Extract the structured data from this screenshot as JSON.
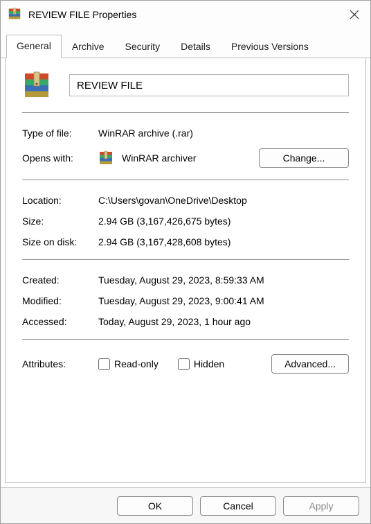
{
  "window": {
    "title": "REVIEW FILE Properties"
  },
  "tabs": {
    "general": "General",
    "archive": "Archive",
    "security": "Security",
    "details": "Details",
    "previous_versions": "Previous Versions"
  },
  "filename": "REVIEW FILE",
  "labels": {
    "type_of_file": "Type of file:",
    "opens_with": "Opens with:",
    "location": "Location:",
    "size": "Size:",
    "size_on_disk": "Size on disk:",
    "created": "Created:",
    "modified": "Modified:",
    "accessed": "Accessed:",
    "attributes": "Attributes:"
  },
  "values": {
    "type_of_file": "WinRAR archive (.rar)",
    "opens_with": "WinRAR archiver",
    "location": "C:\\Users\\govan\\OneDrive\\Desktop",
    "size": "2.94 GB (3,167,426,675 bytes)",
    "size_on_disk": "2.94 GB (3,167,428,608 bytes)",
    "created": "Tuesday, August 29, 2023, 8:59:33 AM",
    "modified": "Tuesday, August 29, 2023, 9:00:41 AM",
    "accessed": "Today, August 29, 2023, 1 hour ago"
  },
  "attributes": {
    "read_only": "Read-only",
    "hidden": "Hidden"
  },
  "buttons": {
    "change": "Change...",
    "advanced": "Advanced...",
    "ok": "OK",
    "cancel": "Cancel",
    "apply": "Apply"
  }
}
